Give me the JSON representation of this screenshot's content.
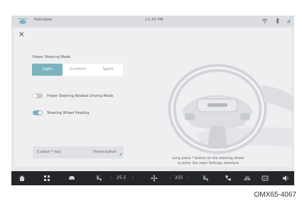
{
  "status_bar": {
    "app_name": "Helicopter",
    "time": "11:30 PM"
  },
  "power_steering": {
    "title": "Power Steering Mode",
    "modes": [
      "Light",
      "Comfort",
      "Sport"
    ],
    "selected": "Light"
  },
  "toggles": [
    {
      "label": "Power Steering Related Driving Mode",
      "on": false
    },
    {
      "label": "Steering Wheel Heating",
      "on": true
    }
  ],
  "custom_key": {
    "label": "Custom * key",
    "value": "Home button"
  },
  "hint": {
    "line1": "Long press * button on the steering wheel",
    "line2": "to enter the main Settings interface"
  },
  "dock": {
    "temp_left": "25.5",
    "temp_right": "255"
  },
  "caption": "OMX65-4067",
  "colors": {
    "accent": "#7ab2bd",
    "dock": "#24262b",
    "background": "#e6e7e9"
  }
}
